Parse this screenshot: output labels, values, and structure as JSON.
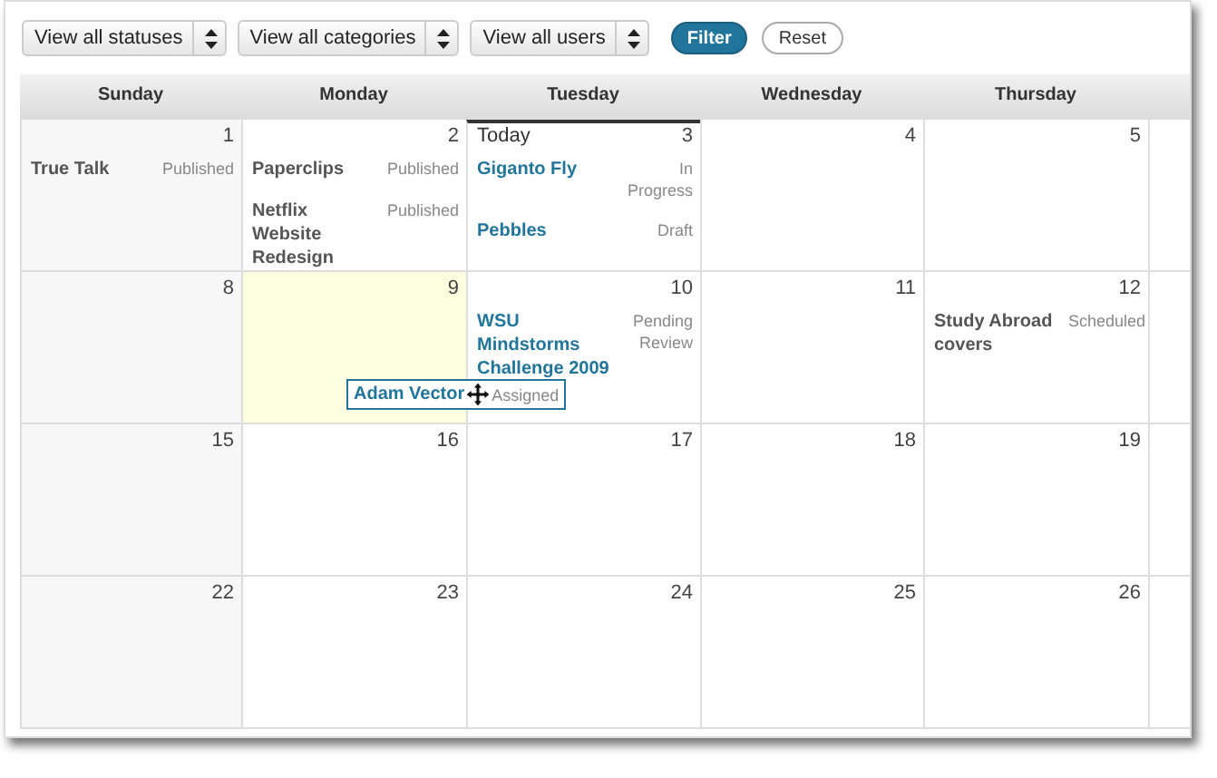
{
  "filters": [
    {
      "label": "View all statuses"
    },
    {
      "label": "View all categories"
    },
    {
      "label": "View all users"
    }
  ],
  "buttons": [
    {
      "label": "Filter",
      "kind": "primary"
    },
    {
      "label": "Reset",
      "kind": "secondary"
    }
  ],
  "weekdays": [
    "Sunday",
    "Monday",
    "Tuesday",
    "Wednesday",
    "Thursday"
  ],
  "weeks": [
    {
      "days": [
        {
          "date": "1",
          "posts": [
            {
              "title": "True Talk",
              "status": "Published",
              "color": "#555555"
            }
          ]
        },
        {
          "date": "2",
          "posts": [
            {
              "title": "Paperclips",
              "status": "Published",
              "color": "#555555"
            },
            {
              "title": "Netflix Website Redesign",
              "status": "Published",
              "color": "#555555"
            }
          ]
        },
        {
          "date": "3",
          "today": "Today",
          "posts": [
            {
              "title": "Giganto Fly",
              "status": "In Progress",
              "color": "#21759b"
            },
            {
              "title": "Pebbles",
              "status": "Draft",
              "color": "#21759b"
            }
          ]
        },
        {
          "date": "4"
        },
        {
          "date": "5"
        }
      ]
    },
    {
      "days": [
        {
          "date": "8"
        },
        {
          "date": "9",
          "selected": true,
          "dragging": {
            "title": "Adam Vector",
            "status": "Assigned",
            "color": "#21759b"
          }
        },
        {
          "date": "10",
          "posts": [
            {
              "title": "WSU Mindstorms Challenge 2009",
              "status": "Pending Review",
              "color": "#21759b"
            }
          ]
        },
        {
          "date": "11"
        },
        {
          "date": "12",
          "posts": [
            {
              "title": "Study Abroad covers",
              "status": "Scheduled",
              "color": "#555555"
            }
          ]
        }
      ]
    },
    {
      "days": [
        {
          "date": "15"
        },
        {
          "date": "16"
        },
        {
          "date": "17"
        },
        {
          "date": "18"
        },
        {
          "date": "19"
        }
      ]
    },
    {
      "days": [
        {
          "date": "22"
        },
        {
          "date": "23"
        },
        {
          "date": "24"
        },
        {
          "date": "25"
        },
        {
          "date": "26"
        }
      ]
    }
  ]
}
